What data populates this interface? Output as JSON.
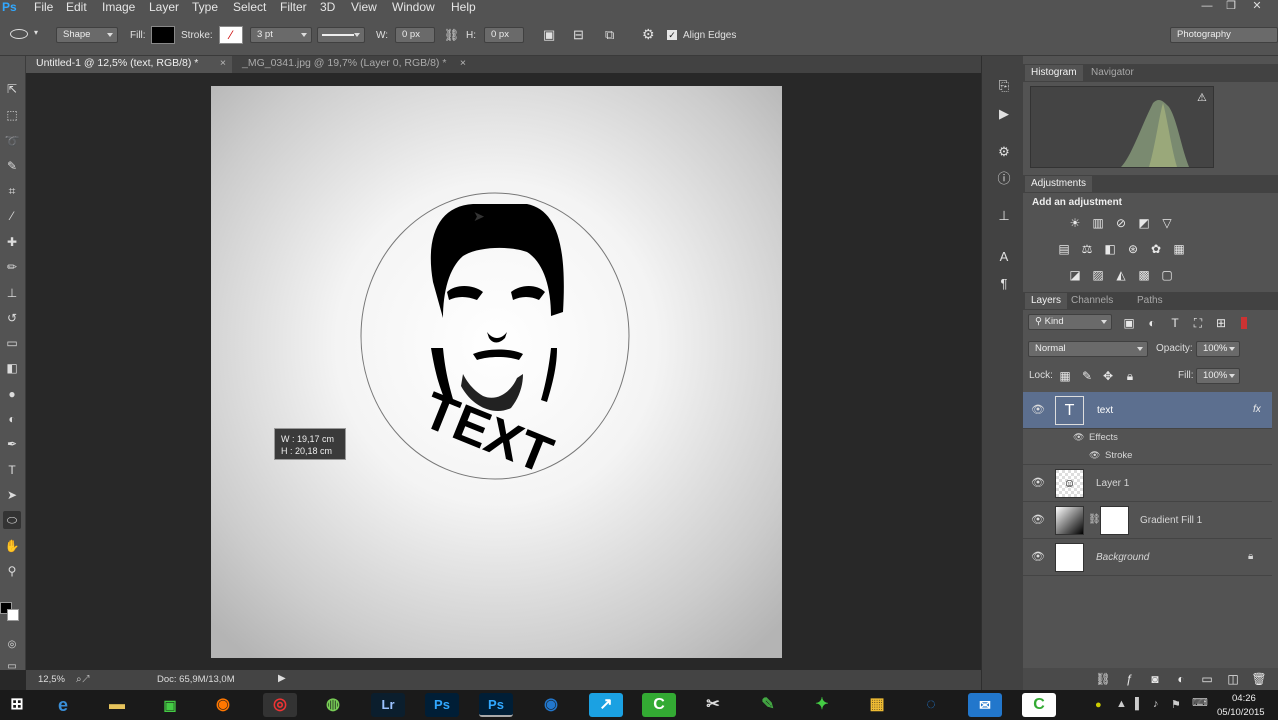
{
  "app": {
    "logo": "Ps"
  },
  "menu": [
    "File",
    "Edit",
    "Image",
    "Layer",
    "Type",
    "Select",
    "Filter",
    "3D",
    "View",
    "Window",
    "Help"
  ],
  "options": {
    "tool_mode": "Shape",
    "fill_label": "Fill:",
    "stroke_label": "Stroke:",
    "stroke_size": "3 pt",
    "w_label": "W:",
    "w_value": "0 px",
    "h_label": "H:",
    "h_value": "0 px",
    "align_edges": "Align Edges",
    "workspace": "Photography"
  },
  "tabs": [
    {
      "label": "Untitled-1 @ 12,5% (text, RGB/8) *",
      "close": "×"
    },
    {
      "label": "_MG_0341.jpg @ 19,7% (Layer 0, RGB/8) *",
      "close": "×"
    }
  ],
  "canvas": {
    "text_art": "TEXT",
    "tooltip_w": "W :   19,17 cm",
    "tooltip_h": "H :   20,18 cm"
  },
  "status": {
    "zoom": "12,5%",
    "doc": "Doc: 65,9M/13,0M"
  },
  "panels": {
    "histogram_tab": "Histogram",
    "navigator_tab": "Navigator",
    "adjustments_title": "Adjustments",
    "add_adjustment": "Add an adjustment",
    "layers_tab": "Layers",
    "channels_tab": "Channels",
    "paths_tab": "Paths",
    "kind": "Kind",
    "blend_mode": "Normal",
    "opacity_label": "Opacity:",
    "opacity_value": "100%",
    "lock_label": "Lock:",
    "fill_label": "Fill:",
    "fill_value": "100%"
  },
  "layers": [
    {
      "name": "text",
      "fx": "fx"
    },
    {
      "name": "Effects"
    },
    {
      "name": "Stroke"
    },
    {
      "name": "Layer 1"
    },
    {
      "name": "Gradient Fill 1"
    },
    {
      "name": "Background"
    }
  ],
  "taskbar": {
    "time": "04:26",
    "date": "05/10/2015",
    "apps": [
      "Lr",
      "Ps",
      "Ps"
    ]
  },
  "colors": {
    "accent_selected": "#5c6f8f",
    "ps_blue": "#31a8ff",
    "lr_blue": "#9cc3ff"
  }
}
